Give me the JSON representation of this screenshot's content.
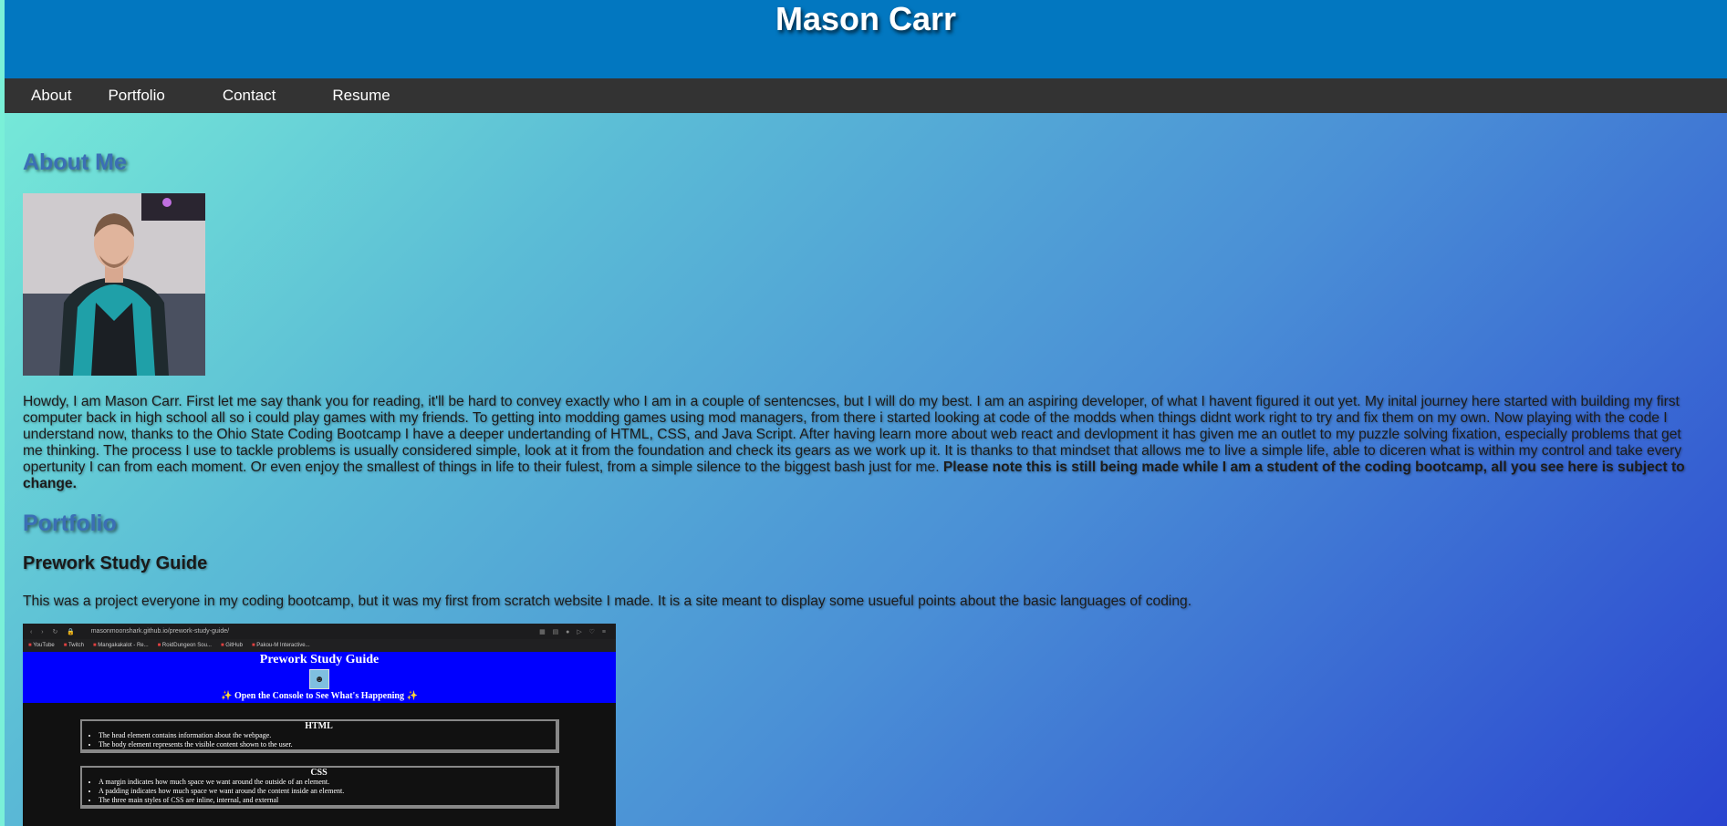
{
  "site_title": "Mason Carr",
  "nav": [
    "About",
    "Portfolio",
    "Contact",
    "Resume"
  ],
  "about": {
    "heading": "About Me",
    "bio": "Howdy, I am Mason Carr. First let me say thank you for reading, it'll be hard to convey exactly who I am in a couple of sentencses, but I will do my best. I am an aspiring developer, of what I havent figured it out yet. My inital journey here started with building my first computer back in high school all so i could play games with my friends. To getting into modding games using mod managers, from there i started looking at code of the modds when things didnt work right to try and fix them on my own. Now playing with the code I understand now, thanks to the Ohio State Coding Bootcamp I have a deeper undertanding of HTML, CSS, and Java Script. After having learn more about web react and devlopment it has given me an outlet to my puzzle solving fixation, especially problems that get me thinking. The process I use to tackle problems is usually considered simple, look at it from the foundation and check its gears as we work up it. It is thanks to that mindset that allows me to live a simple life, able to diceren what is within my control and take every opertunity I can from each moment. Or even enjoy the smallest of things in life to their fulest, from a simple silence to the biggest bash just for me.",
    "bio_note": "Please note this is still being made while I am a student of the coding bootcamp, all you see here is subject to change."
  },
  "portfolio": {
    "heading": "Portfolio",
    "project": {
      "title": "Prework Study Guide",
      "description": "This was a project everyone in my coding bootcamp, but it was my first from scratch website I made. It is a site meant to display some usueful points about the basic languages of coding.",
      "screenshot": {
        "url": "masonmoonshark.github.io/prework-study-guide/",
        "bookmarks": [
          "YouTube",
          "Twitch",
          "Mangakakalot - Re...",
          "RoidDungeon Sou...",
          "GitHub",
          "Pakou-M Interactive..."
        ],
        "page_title": "Prework Study Guide",
        "console_note": "✨ Open the Console to See What's Happening ✨",
        "sections": [
          {
            "title": "HTML",
            "items": [
              "The head element contains information about the webpage.",
              "The body element represents the visible content shown to the user."
            ]
          },
          {
            "title": "CSS",
            "items": [
              "A margin indicates how much space we want around the outside of an element.",
              "A padding indicates how much space we want around the content inside an element.",
              "The three main styles of CSS are inline, internal, and external"
            ]
          }
        ]
      }
    }
  }
}
